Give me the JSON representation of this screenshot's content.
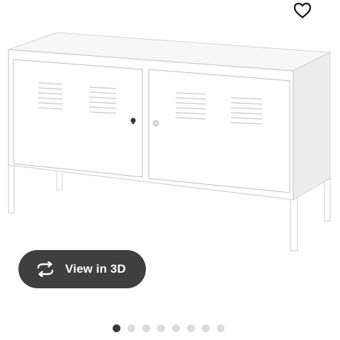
{
  "gallery": {
    "view_3d_label": "View in 3D",
    "favourite_icon": "heart-icon",
    "view_3d_icon": "rotate-3d-icon",
    "image_count": 8,
    "active_index": 0
  },
  "colors": {
    "button_bg": "#3f3f3f",
    "dot_active": "#3a3a3a",
    "dot_inactive": "#dcdcdc"
  }
}
